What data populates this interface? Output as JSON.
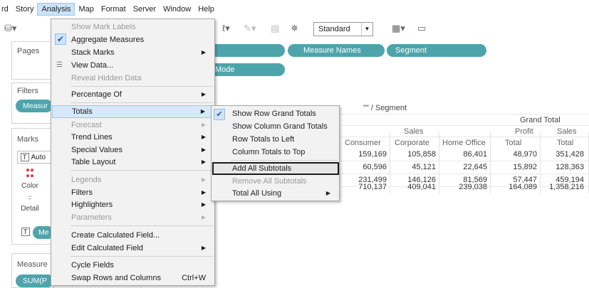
{
  "menubar": {
    "items": [
      {
        "label": "rd"
      },
      {
        "label": "Story"
      },
      {
        "label": "Analysis"
      },
      {
        "label": "Map"
      },
      {
        "label": "Format"
      },
      {
        "label": "Server"
      },
      {
        "label": "Window"
      },
      {
        "label": "Help"
      }
    ]
  },
  "toolbar": {
    "fit_dropdown": "Standard"
  },
  "left_panel": {
    "pages_title": "Pages",
    "filters_title": "Filters",
    "filter_pill": "Measur",
    "marks_title": "Marks",
    "mark_type": "Auto",
    "color_label": "Color",
    "detail_label": "Detail",
    "text_pill": "Me",
    "measure_title": "Measure",
    "measure_pill": "SUM(P"
  },
  "shelves": {
    "columns_pills": [
      "Measure Names",
      "Segment"
    ],
    "rows_pill": "Mode"
  },
  "table": {
    "header_title": "\"\" / Segment",
    "grand_total": "Grand Total",
    "sales_label": "Sales",
    "sub_headers": [
      "Consumer",
      "Corporate",
      "Home Office",
      "Total",
      "Total"
    ],
    "grand_headers": [
      "Profit",
      "Sales"
    ],
    "rows": [
      [
        "159,169",
        "105,858",
        "86,401",
        "48,970",
        "351,428"
      ],
      [
        "60,596",
        "45,121",
        "22,645",
        "15,892",
        "128,363"
      ],
      [
        "231,499",
        "146,126",
        "81,569",
        "57,447",
        "459,194"
      ],
      [
        "710,137",
        "409,041",
        "239,038",
        "164,089",
        "1,358,216"
      ]
    ]
  },
  "analysis_menu": {
    "items": [
      {
        "label": "Show Mark Labels",
        "disabled": true
      },
      {
        "label": "Aggregate Measures",
        "checked": true
      },
      {
        "label": "Stack Marks",
        "submenu": true
      },
      {
        "label": "View Data...",
        "icon": "table-icon"
      },
      {
        "label": "Reveal Hidden Data",
        "disabled": true
      },
      {
        "label": "Percentage Of",
        "submenu": true
      },
      {
        "label": "Totals",
        "submenu": true,
        "highlighted": true
      },
      {
        "label": "Forecast",
        "submenu": true,
        "disabled": true
      },
      {
        "label": "Trend Lines",
        "submenu": true
      },
      {
        "label": "Special Values",
        "submenu": true
      },
      {
        "label": "Table Layout",
        "submenu": true
      },
      {
        "label": "Legends",
        "submenu": true,
        "disabled": true
      },
      {
        "label": "Filters",
        "submenu": true
      },
      {
        "label": "Highlighters",
        "submenu": true
      },
      {
        "label": "Parameters",
        "submenu": true,
        "disabled": true
      },
      {
        "label": "Create Calculated Field..."
      },
      {
        "label": "Edit Calculated Field",
        "submenu": true
      },
      {
        "label": "Cycle Fields"
      },
      {
        "label": "Swap Rows and Columns",
        "shortcut": "Ctrl+W"
      }
    ]
  },
  "totals_submenu": {
    "items": [
      {
        "label": "Show Row Grand Totals",
        "checked": true
      },
      {
        "label": "Show Column Grand Totals"
      },
      {
        "label": "Row Totals to Left"
      },
      {
        "label": "Column Totals to Top"
      },
      {
        "label": "Add All Subtotals",
        "focused": true
      },
      {
        "label": "Remove All Subtotals",
        "disabled": true
      },
      {
        "label": "Total All Using",
        "submenu": true
      }
    ]
  }
}
